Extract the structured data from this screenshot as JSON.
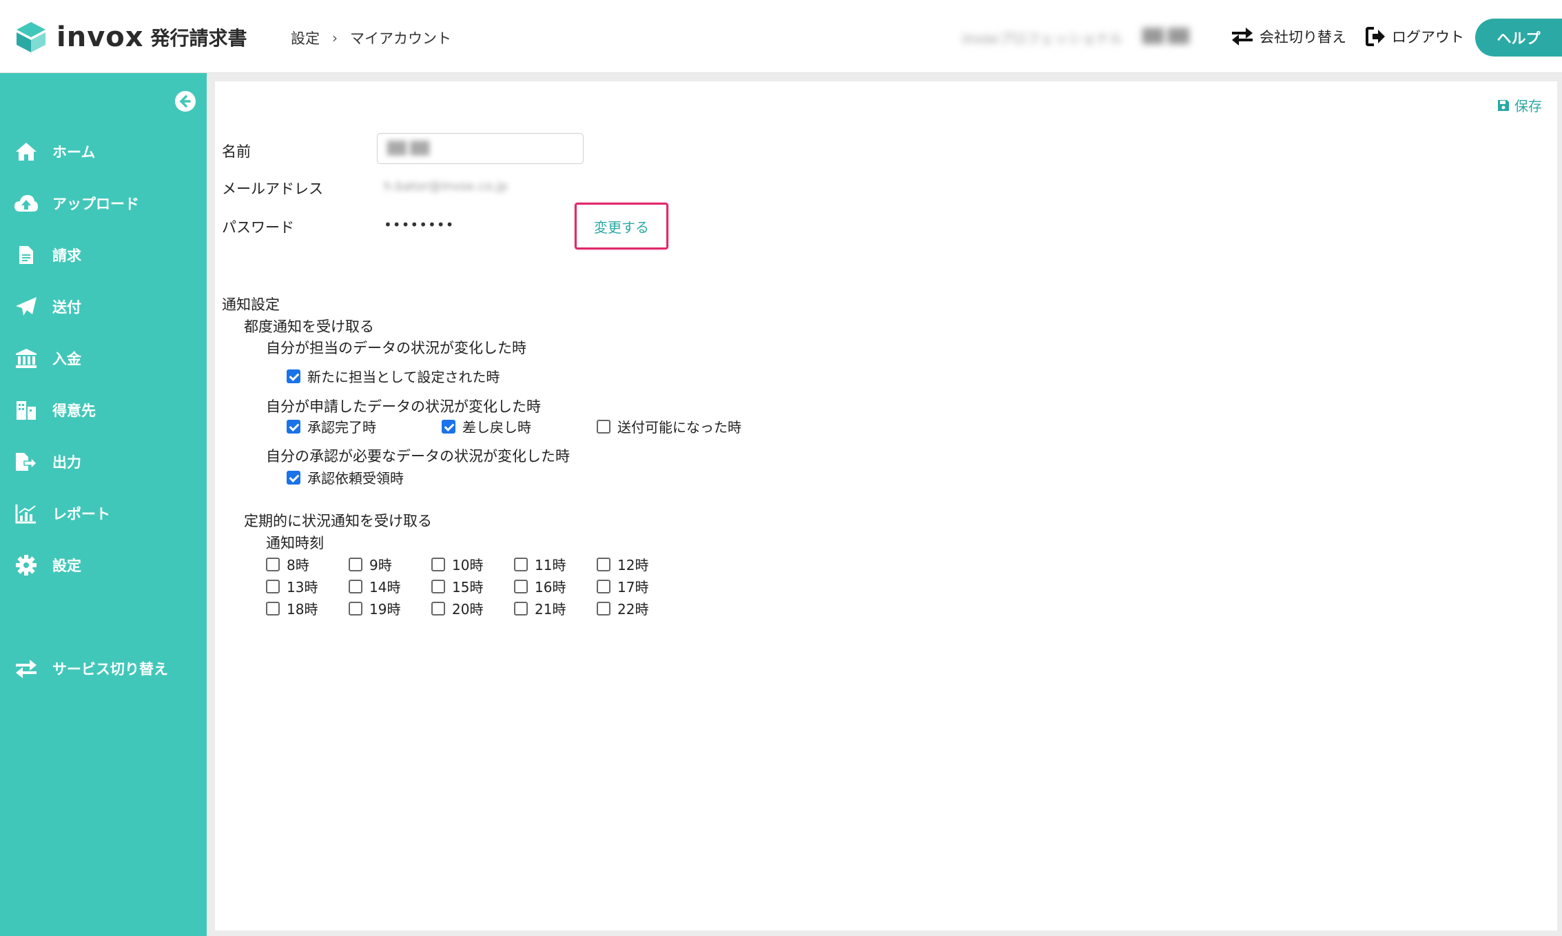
{
  "header": {
    "logo_text": "invox",
    "logo_sub": "発行請求書",
    "breadcrumb": [
      "設定",
      "マイアカウント"
    ],
    "company_name": "invoxプロフェッショナル",
    "user_name": "██ ██",
    "switch_company": "会社切り替え",
    "logout": "ログアウト",
    "help": "ヘルプ"
  },
  "sidebar": {
    "items": [
      {
        "label": "ホーム",
        "icon": "home-icon"
      },
      {
        "label": "アップロード",
        "icon": "cloud-upload-icon"
      },
      {
        "label": "請求",
        "icon": "document-icon"
      },
      {
        "label": "送付",
        "icon": "paper-plane-icon"
      },
      {
        "label": "入金",
        "icon": "bank-icon"
      },
      {
        "label": "得意先",
        "icon": "building-icon"
      },
      {
        "label": "出力",
        "icon": "file-export-icon"
      },
      {
        "label": "レポート",
        "icon": "chart-icon"
      },
      {
        "label": "設定",
        "icon": "gear-icon"
      }
    ],
    "service_switch": "サービス切り替え"
  },
  "main": {
    "save": "保存",
    "name_label": "名前",
    "name_value": "██ ██",
    "email_label": "メールアドレス",
    "email_value": "h.bator@invox.co.jp",
    "password_label": "パスワード",
    "password_value": "••••••••",
    "change_button": "変更する",
    "notification": {
      "title": "通知設定",
      "each_time": "都度通知を受け取る",
      "group1_title": "自分が担当のデータの状況が変化した時",
      "group1_items": [
        {
          "label": "新たに担当として設定された時",
          "checked": true
        }
      ],
      "group2_title": "自分が申請したデータの状況が変化した時",
      "group2_items": [
        {
          "label": "承認完了時",
          "checked": true
        },
        {
          "label": "差し戻し時",
          "checked": true
        },
        {
          "label": "送付可能になった時",
          "checked": false
        }
      ],
      "group3_title": "自分の承認が必要なデータの状況が変化した時",
      "group3_items": [
        {
          "label": "承認依頼受領時",
          "checked": true
        }
      ],
      "periodic": "定期的に状況通知を受け取る",
      "time_label": "通知時刻",
      "hours": [
        "8時",
        "9時",
        "10時",
        "11時",
        "12時",
        "13時",
        "14時",
        "15時",
        "16時",
        "17時",
        "18時",
        "19時",
        "20時",
        "21時",
        "22時"
      ]
    }
  },
  "colors": {
    "teal": "#41c7b9",
    "accent": "#2ba9a4",
    "highlight": "#e0296a",
    "check": "#1a73e8"
  }
}
